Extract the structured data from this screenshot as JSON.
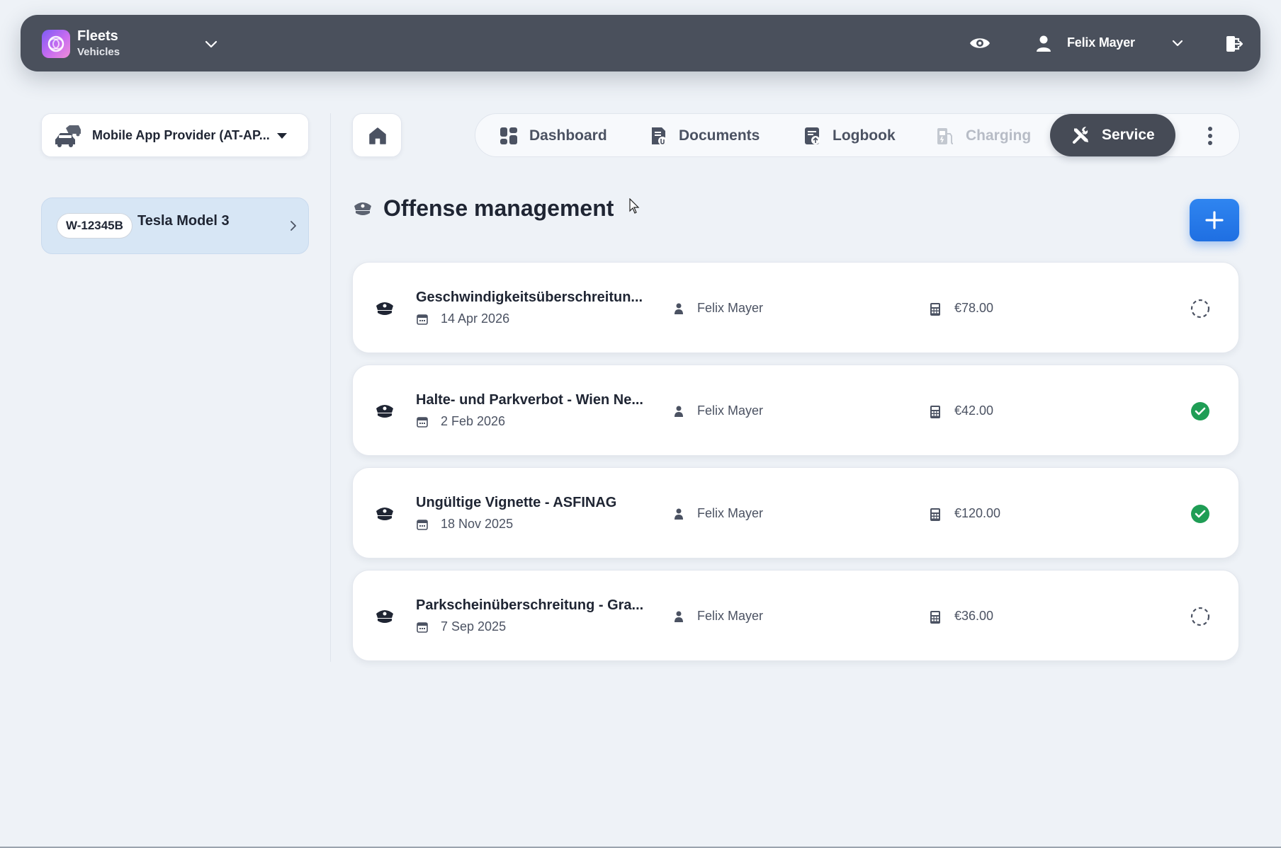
{
  "app": {
    "title": "Fleets",
    "subtitle": "Vehicles"
  },
  "topbar": {
    "user_name": "Felix Mayer"
  },
  "sidebar": {
    "provider_select": "Mobile App Provider (AT-AP...",
    "vehicle": {
      "plate": "W-12345B",
      "name": "Tesla Model 3"
    }
  },
  "tabs": [
    {
      "label": "Dashboard",
      "icon": "dashboard-icon",
      "state": "normal"
    },
    {
      "label": "Documents",
      "icon": "documents-icon",
      "state": "normal"
    },
    {
      "label": "Logbook",
      "icon": "logbook-icon",
      "state": "normal"
    },
    {
      "label": "Charging",
      "icon": "charging-icon",
      "state": "disabled"
    },
    {
      "label": "Service",
      "icon": "service-tools-icon",
      "state": "active"
    }
  ],
  "section": {
    "title": "Offense management"
  },
  "offenses": [
    {
      "title": "Geschwindigkeitsüberschreitun...",
      "date": "14 Apr 2026",
      "person": "Felix Mayer",
      "amount": "€78.00",
      "status": "pending"
    },
    {
      "title": "Halte- und Parkverbot - Wien Ne...",
      "date": "2 Feb 2026",
      "person": "Felix Mayer",
      "amount": "€42.00",
      "status": "done"
    },
    {
      "title": "Ungültige Vignette - ASFINAG",
      "date": "18 Nov 2025",
      "person": "Felix Mayer",
      "amount": "€120.00",
      "status": "done"
    },
    {
      "title": "Parkscheinüberschreitung - Gra...",
      "date": "7 Sep 2025",
      "person": "Felix Mayer",
      "amount": "€36.00",
      "status": "pending"
    }
  ],
  "colors": {
    "topbar": "#4a505c",
    "accent_blue": "#2579ea",
    "active_tab": "#464b56",
    "vehicle_card": "#d7e6f5",
    "success_green": "#1f9d55"
  }
}
